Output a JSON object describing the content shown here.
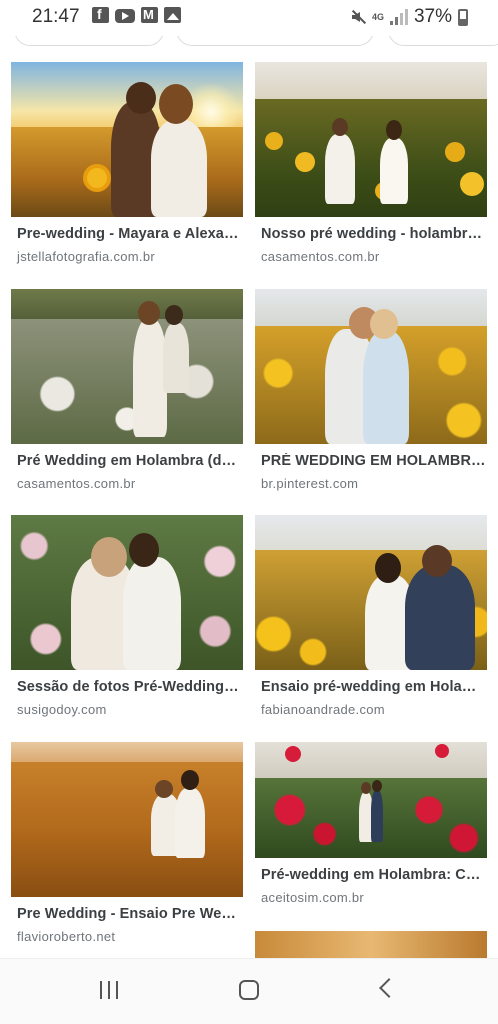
{
  "status_bar": {
    "time": "21:47",
    "battery": "37%",
    "network": "4G",
    "left_icons": [
      "facebook-icon",
      "youtube-icon",
      "gmail-icon",
      "gallery-icon"
    ],
    "right_icons": [
      "mute-icon",
      "data-icon",
      "signal-icon",
      "battery-icon"
    ]
  },
  "results": [
    {
      "title": "Pre-wedding - Mayara e Alexa…",
      "source": "jstellafotografia.com.br"
    },
    {
      "title": "Nosso pré wedding - holambr…",
      "source": "casamentos.com.br"
    },
    {
      "title": "Pré Wedding em Holambra (d…",
      "source": "casamentos.com.br"
    },
    {
      "title": "PRÉ WEDDING EM HOLAMBR…",
      "source": "br.pinterest.com"
    },
    {
      "title": "Sessão de fotos Pré-Wedding…",
      "source": "susigodoy.com"
    },
    {
      "title": "Ensaio pré-wedding em Hola…",
      "source": "fabianoandrade.com"
    },
    {
      "title": "Pre Wedding - Ensaio Pre We…",
      "source": "flavioroberto.net"
    },
    {
      "title": "Pré-wedding em Holambra: C…",
      "source": "aceitosim.com.br"
    }
  ],
  "nav_bar": {
    "buttons": [
      "recent-apps-icon",
      "home-icon",
      "back-icon"
    ]
  }
}
